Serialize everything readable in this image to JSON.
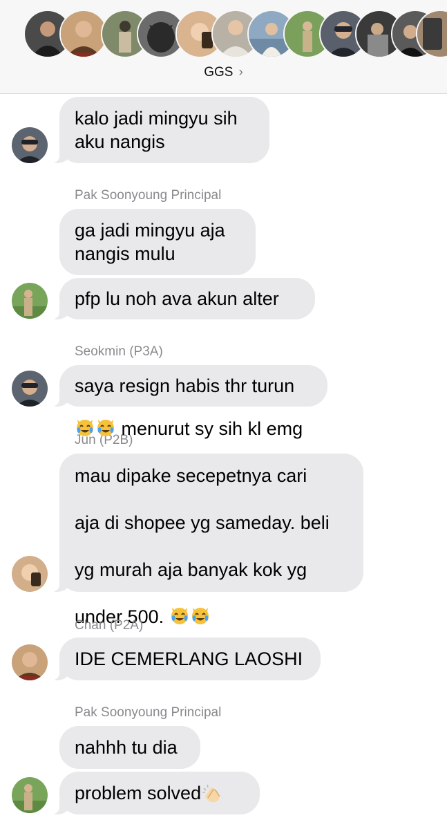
{
  "header": {
    "group_name": "GGS",
    "chevron": "›",
    "avatars": [
      {
        "name": "member-1",
        "bg": "#4a4a4a",
        "accent": "#1c1c1c"
      },
      {
        "name": "member-2",
        "bg": "#c9a27a",
        "accent": "#5a3a22"
      },
      {
        "name": "member-3",
        "bg": "#7f8a6a",
        "accent": "#3e3a2f"
      },
      {
        "name": "member-4",
        "bg": "#6b6b6b",
        "accent": "#2a2a2a"
      },
      {
        "name": "member-5",
        "bg": "#d9b48f",
        "accent": "#3a2a1e"
      },
      {
        "name": "member-6",
        "bg": "#b7b1a6",
        "accent": "#e8e4dd"
      },
      {
        "name": "member-7",
        "bg": "#8fa9c2",
        "accent": "#f1eee8"
      },
      {
        "name": "member-8",
        "bg": "#7aa05c",
        "accent": "#c8b28a"
      },
      {
        "name": "member-9",
        "bg": "#59606b",
        "accent": "#22262c"
      },
      {
        "name": "member-10",
        "bg": "#3a3a3a",
        "accent": "#8a8a8a"
      },
      {
        "name": "member-11",
        "bg": "#5a5a5a",
        "accent": "#121212"
      },
      {
        "name": "member-12",
        "bg": "#a08870",
        "accent": "#3a3a3a"
      }
    ]
  },
  "messages": {
    "m1": {
      "text": "kalo jadi mingyu sih\naku nangis"
    },
    "sender2": "Pak Soonyoung Principal",
    "m2": {
      "text": "ga jadi mingyu aja\nnangis mulu"
    },
    "m3": {
      "text": "pfp lu noh ava akun alter"
    },
    "sender3": "Seokmin (P3A)",
    "m4": {
      "text": "saya resign habis thr turun"
    },
    "sender4": "Jun (P2B)",
    "m5": {
      "line1": " menurut sy sih kl emg",
      "line2": "mau dipake secepetnya cari",
      "line3": "aja di shopee yg sameday. beli",
      "line4": "yg murah aja banyak kok yg",
      "line5": "under 500. "
    },
    "sender5": "Chan (P2A)",
    "m6": {
      "text": "IDE CEMERLANG LAOSHI"
    },
    "sender6": "Pak Soonyoung Principal",
    "m7": {
      "text": "nahhh tu dia"
    },
    "m8": {
      "text": "problem solved "
    }
  },
  "colors": {
    "bubble": "#e9e9eb",
    "sender_label": "#8a8a8e",
    "header_bg": "#f7f7f7"
  },
  "icons": {
    "joy_cat": "cat-face-with-tears-of-joy-emoji",
    "clap": "clapping-hands-emoji"
  }
}
